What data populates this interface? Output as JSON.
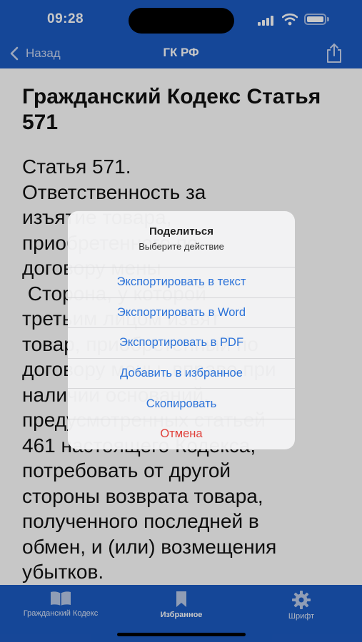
{
  "status_bar": {
    "time": "09:28"
  },
  "nav": {
    "back_label": "Назад",
    "title": "ГК РФ",
    "share_icon": "share-icon"
  },
  "article": {
    "title": "Гражданский Кодекс Статья 571",
    "body": "Статья 571.\nОтветственность за\nизъятие товара,\nприобретенного по\nдоговору мены\n Сторона, у которой\nтретьим лицом изъят\nтовар, приобретенный по\nдоговору мены, вправе при\nналичии оснований,\nпредусмотренных статьей\n461 настоящего Кодекса,\nпотребовать от другой\nстороны возврата товара,\nполученного последней в\nобмен, и (или) возмещения\nубытков."
  },
  "action_sheet": {
    "title": "Поделиться",
    "message": "Выберите действие",
    "actions": [
      "Экспортировать в текст",
      "Экспортировать в Word",
      "Экспортировать в PDF",
      "Добавить в избранное",
      "Скопировать"
    ],
    "cancel": "Отмена"
  },
  "tabbar": {
    "items": [
      {
        "label": "Гражданский Кодекс",
        "icon": "book-icon"
      },
      {
        "label": "Избранное",
        "icon": "bookmark-icon"
      },
      {
        "label": "Шрифт",
        "icon": "gear-icon"
      }
    ],
    "active_index": 1
  },
  "colors": {
    "bar_blue": "#1c5bc3",
    "action_blue": "#2b72d8",
    "destructive_red": "#e0403a"
  }
}
